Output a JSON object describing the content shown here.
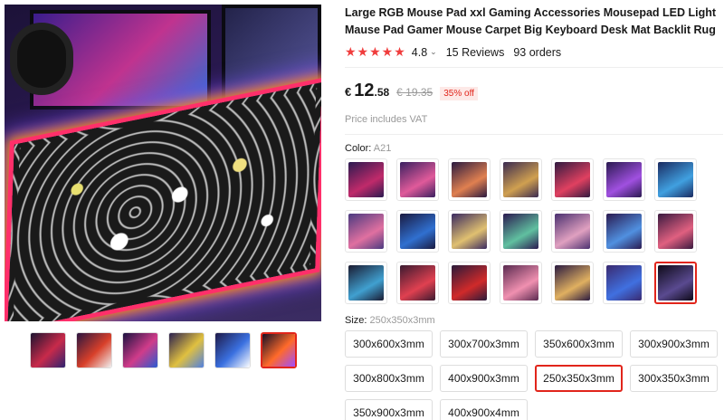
{
  "gallery": {
    "main_image": "mouse-pad-photo",
    "thumbnails": [
      {
        "colors": [
          "#1b1430",
          "#c82a4a",
          "#2e2270"
        ],
        "active": false
      },
      {
        "colors": [
          "#2a1540",
          "#d8402a",
          "#f0f0f0"
        ],
        "active": false
      },
      {
        "colors": [
          "#1a1240",
          "#d03c8a",
          "#2a5ad0"
        ],
        "active": false
      },
      {
        "colors": [
          "#2a2050",
          "#e0c040",
          "#5080e0"
        ],
        "active": false
      },
      {
        "colors": [
          "#1e1a48",
          "#3a70e0",
          "#ffffff"
        ],
        "active": false
      },
      {
        "colors": [
          "#160f26",
          "#ff6a2a",
          "#a04cff"
        ],
        "active": true
      }
    ]
  },
  "product": {
    "title": "Large RGB Mouse Pad xxl Gaming Accessories Mousepad LED Light Mause Pad Gamer Mouse Carpet Big Keyboard Desk Mat Backlit Rug",
    "stars": "★★★★★",
    "rating": "4.8",
    "reviews": "15 Reviews",
    "orders": "93 orders"
  },
  "price": {
    "currency": "€",
    "integer": "12",
    "decimal": ".58",
    "original": "€ 19.35",
    "discount": "35% off",
    "vat_note": "Price includes VAT"
  },
  "color_option": {
    "label": "Color: ",
    "value": "A21",
    "selected_index": 20,
    "swatches": [
      [
        "#2a1a50",
        "#c02a6a"
      ],
      [
        "#3a2060",
        "#e05a9a"
      ],
      [
        "#2a1a40",
        "#e08050"
      ],
      [
        "#3a2a50",
        "#d0a050"
      ],
      [
        "#301a40",
        "#e04060"
      ],
      [
        "#2a1a50",
        "#a050e0"
      ],
      [
        "#1a2a60",
        "#40a0e0"
      ],
      [
        "#4a3a80",
        "#e070a0"
      ],
      [
        "#1a1a40",
        "#3070d0"
      ],
      [
        "#3a2a60",
        "#e0c070"
      ],
      [
        "#2a1a50",
        "#60c0a0"
      ],
      [
        "#4a3070",
        "#e0a0c0"
      ],
      [
        "#2a1a50",
        "#5090e0"
      ],
      [
        "#3a1a40",
        "#e06080"
      ],
      [
        "#1a1a30",
        "#40a0d0"
      ],
      [
        "#3a1a30",
        "#e04050"
      ],
      [
        "#2a1a3a",
        "#d02a2a"
      ],
      [
        "#5a2a50",
        "#f090b0"
      ],
      [
        "#2a1a40",
        "#e0b060"
      ],
      [
        "#3a2a70",
        "#4070e0"
      ],
      [
        "#0e0a18",
        "#5a4a90"
      ]
    ]
  },
  "size_option": {
    "label": "Size: ",
    "value": "250x350x3mm",
    "selected_index": 6,
    "options": [
      "300x600x3mm",
      "300x700x3mm",
      "350x600x3mm",
      "300x900x3mm",
      "300x800x3mm",
      "400x900x3mm",
      "250x350x3mm",
      "300x350x3mm",
      "350x900x3mm",
      "400x900x4mm"
    ]
  }
}
